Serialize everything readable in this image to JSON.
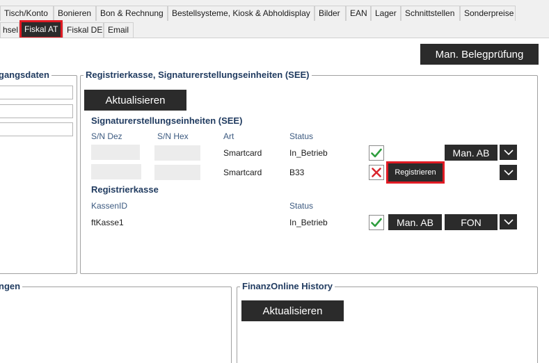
{
  "tabs_row1": [
    "Tisch/Konto",
    "Bonieren",
    "Bon & Rechnung",
    "Bestellsysteme, Kiosk & Abholdisplay",
    "Bilder",
    "EAN",
    "Lager",
    "Schnittstellen",
    "Sonderpreise"
  ],
  "tabs_row2": [
    "hsel",
    "Fiskal AT",
    "Fiskal DE",
    "Email"
  ],
  "active_tab": "Fiskal AT",
  "man_belegpruefung": "Man. Belegprüfung",
  "left_group": {
    "legend": "gangsdaten"
  },
  "see_group": {
    "legend": "Registrierkasse, Signaturerstellungseinheiten (SEE)",
    "refresh_label": "Aktualisieren",
    "see_title": "Signaturerstellungseinheiten (SEE)",
    "columns": {
      "sn_dez": "S/N Dez",
      "sn_hex": "S/N Hex",
      "art": "Art",
      "status": "Status"
    },
    "rows": [
      {
        "art": "Smartcard",
        "status": "In_Betrieb",
        "state": "ok",
        "action": "Man. AB"
      },
      {
        "art": "Smartcard",
        "status": "B33",
        "state": "error",
        "action": "Registrieren"
      }
    ],
    "kasse_title": "Registrierkasse",
    "kasse_columns": {
      "kassen_id": "KassenID",
      "status": "Status"
    },
    "kasse_row": {
      "id": "ftKasse1",
      "status": "In_Betrieb",
      "action1": "Man. AB",
      "action2": "FON"
    }
  },
  "bottom_left": {
    "legend": "ngen"
  },
  "finanzonline": {
    "legend": "FinanzOnline History",
    "refresh_label": "Aktualisieren"
  },
  "colors": {
    "accent_dark": "#2b2b2b",
    "highlight_red": "#e01b24",
    "check_green": "#2e9e3e",
    "x_red": "#d9262e",
    "heading_blue": "#1f3a5f"
  }
}
